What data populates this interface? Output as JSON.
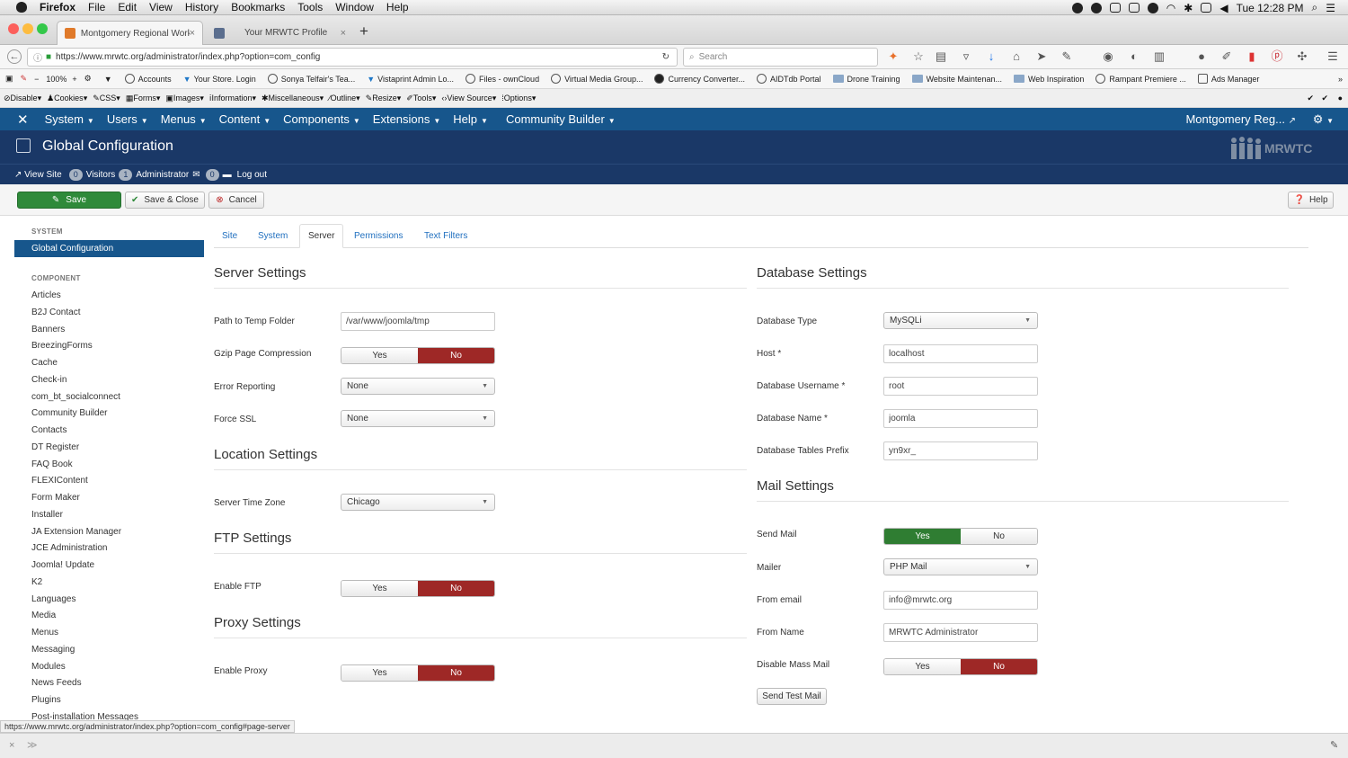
{
  "macbar": {
    "app": "Firefox",
    "menus": [
      "File",
      "Edit",
      "View",
      "History",
      "Bookmarks",
      "Tools",
      "Window",
      "Help"
    ],
    "clock": "Tue 12:28 PM"
  },
  "tabs": [
    {
      "label": "Montgomery Regional Workfo",
      "close": "×"
    },
    {
      "label": "Your MRWTC Profile",
      "close": "×"
    }
  ],
  "new_tab": "+",
  "nav": {
    "url": "https://www.mrwtc.org/administrator/index.php?option=com_config",
    "search_placeholder": "Search"
  },
  "bookmarks": [
    "Accounts",
    "Your Store. Login",
    "Sonya Telfair's Tea...",
    "Vistaprint Admin Lo...",
    "Files - ownCloud",
    "Virtual Media Group...",
    "Currency Converter...",
    "AIDTdb Portal",
    "Drone Training",
    "Website Maintenan...",
    "Web Inspiration",
    "Rampant Premiere ...",
    "Ads Manager"
  ],
  "webdev": {
    "zoom": "100%",
    "items": [
      "Disable",
      "Cookies",
      "CSS",
      "Forms",
      "Images",
      "Information",
      "Miscellaneous",
      "Outline",
      "Resize",
      "Tools",
      "View Source",
      "Options"
    ]
  },
  "jnav": {
    "items": [
      "System",
      "Users",
      "Menus",
      "Content",
      "Components",
      "Extensions",
      "Help",
      "Community Builder"
    ],
    "site": "Montgomery Reg..."
  },
  "header": {
    "title": "Global Configuration",
    "logo": "MRWTC"
  },
  "subhead": {
    "view_site": "View Site",
    "visitors_count": "0",
    "visitors": "Visitors",
    "admin_count": "1",
    "admin": "Administrator",
    "msg_count": "0",
    "logout": "Log out"
  },
  "toolbar": {
    "save": "Save",
    "save_close": "Save & Close",
    "cancel": "Cancel",
    "help": "Help"
  },
  "sidebar": {
    "system_head": "SYSTEM",
    "active": "Global Configuration",
    "component_head": "COMPONENT",
    "items": [
      "Articles",
      "B2J Contact",
      "Banners",
      "BreezingForms",
      "Cache",
      "Check-in",
      "com_bt_socialconnect",
      "Community Builder",
      "Contacts",
      "DT Register",
      "FAQ Book",
      "FLEXIContent",
      "Form Maker",
      "Installer",
      "JA Extension Manager",
      "JCE Administration",
      "Joomla! Update",
      "K2",
      "Languages",
      "Media",
      "Menus",
      "Messaging",
      "Modules",
      "News Feeds",
      "Plugins",
      "Post-installation Messages"
    ]
  },
  "cfgtabs": [
    "Site",
    "System",
    "Server",
    "Permissions",
    "Text Filters"
  ],
  "server": {
    "title": "Server Settings",
    "temp_label": "Path to Temp Folder",
    "temp_value": "/var/www/joomla/tmp",
    "gzip_label": "Gzip Page Compression",
    "error_label": "Error Reporting",
    "error_value": "None",
    "ssl_label": "Force SSL",
    "ssl_value": "None"
  },
  "location": {
    "title": "Location Settings",
    "tz_label": "Server Time Zone",
    "tz_value": "Chicago"
  },
  "ftp": {
    "title": "FTP Settings",
    "enable_label": "Enable FTP"
  },
  "proxy": {
    "title": "Proxy Settings",
    "enable_label": "Enable Proxy"
  },
  "yesno": {
    "yes": "Yes",
    "no": "No"
  },
  "database": {
    "title": "Database Settings",
    "type_label": "Database Type",
    "type_value": "MySQLi",
    "host_label": "Host *",
    "host_value": "localhost",
    "user_label": "Database Username *",
    "user_value": "root",
    "name_label": "Database Name *",
    "name_value": "joomla",
    "prefix_label": "Database Tables Prefix",
    "prefix_value": "yn9xr_"
  },
  "mail": {
    "title": "Mail Settings",
    "send_label": "Send Mail",
    "mailer_label": "Mailer",
    "mailer_value": "PHP Mail",
    "from_email_label": "From email",
    "from_email_value": "info@mrwtc.org",
    "from_name_label": "From Name",
    "from_name_value": "MRWTC Administrator",
    "mass_label": "Disable Mass Mail",
    "test_button": "Send Test Mail"
  },
  "status_url": "https://www.mrwtc.org/administrator/index.php?option=com_config#page-server",
  "colors": {
    "joomla_nav": "#17568c",
    "joomla_header": "#1a3867",
    "save_green": "#2f8a3a",
    "toggle_no": "#9e2826",
    "toggle_yes": "#2f7d32"
  }
}
